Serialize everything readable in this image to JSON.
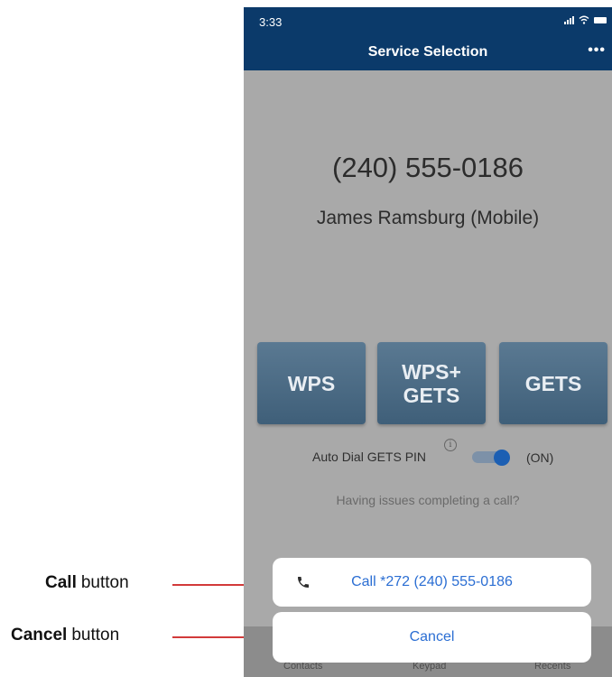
{
  "annotations": {
    "call": {
      "bold": "Call",
      "rest": "button"
    },
    "cancel": {
      "bold": "Cancel",
      "rest": "button"
    }
  },
  "statusbar": {
    "time": "3:33"
  },
  "header": {
    "title": "Service Selection",
    "more_label": "•••"
  },
  "call_target": {
    "number": "(240) 555-0186",
    "contact": "James Ramsburg (Mobile)"
  },
  "services": {
    "wps": {
      "lines": [
        "WPS"
      ]
    },
    "wps_gets": {
      "lines": [
        "WPS+",
        "GETS"
      ]
    },
    "gets": {
      "lines": [
        "GETS"
      ]
    }
  },
  "auto_dial": {
    "label": "Auto Dial GETS PIN",
    "info_glyph": "i",
    "state_label": "(ON)",
    "enabled": true
  },
  "help_link": "Having issues completing a call?",
  "action_sheet": {
    "call_label": "Call *272 (240) 555-0186",
    "call_icon": "phone-icon",
    "cancel_label": "Cancel"
  },
  "tabs": {
    "contacts": "Contacts",
    "keypad": "Keypad",
    "recents": "Recents"
  },
  "colors": {
    "header_bg": "#0b3a6a",
    "accent": "#2b6ed3",
    "annotation_line": "#d23a3a"
  }
}
